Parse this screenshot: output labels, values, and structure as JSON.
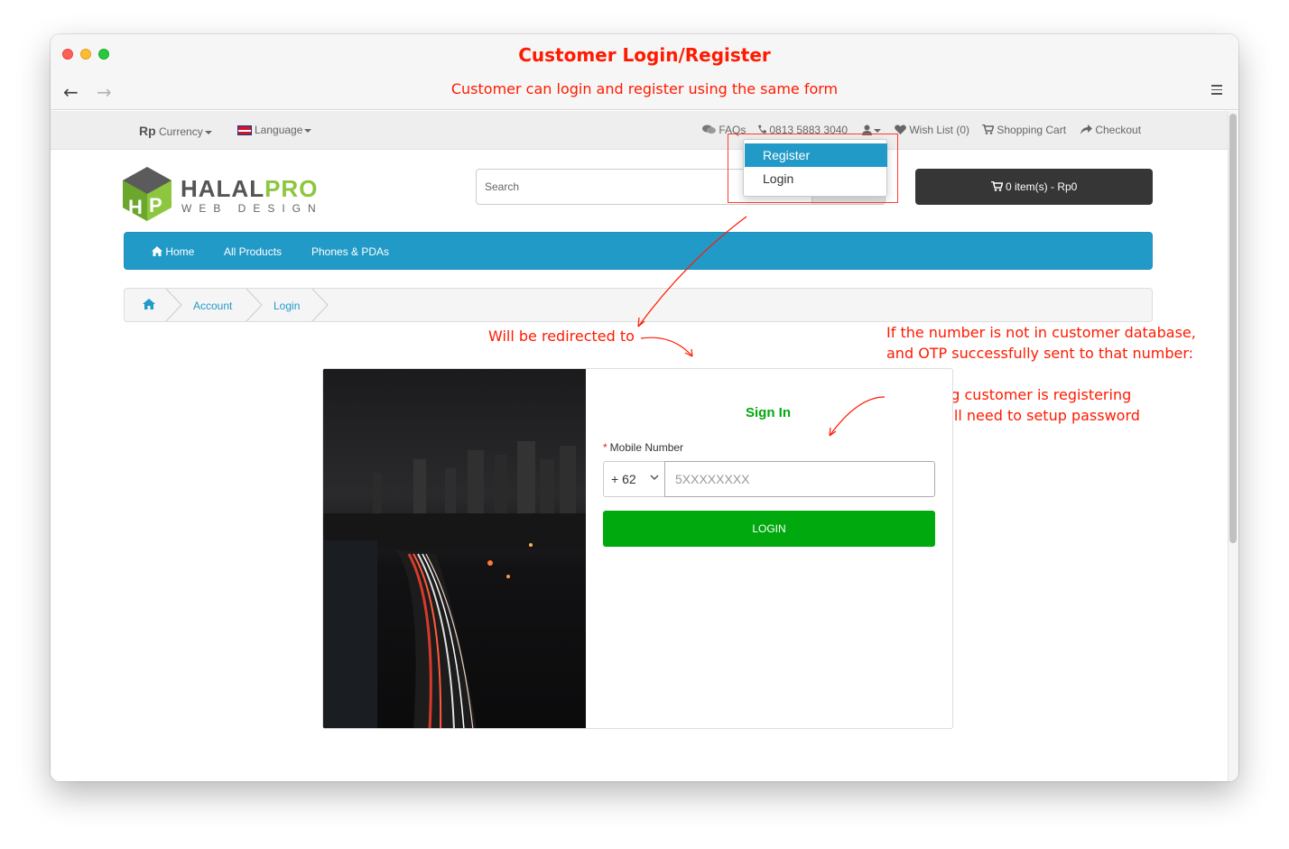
{
  "window": {
    "title": "Customer Login/Register",
    "subtitle": "Customer can login and register using the same form"
  },
  "topbar": {
    "currency_symbol": "Rp",
    "currency_label": "Currency",
    "language_label": "Language",
    "faqs": "FAQs",
    "phone": "0813 5883 3040",
    "wishlist": "Wish List (0)",
    "cart": "Shopping Cart",
    "checkout": "Checkout"
  },
  "account_dropdown": {
    "items": [
      "Register",
      "Login"
    ],
    "active": "Register"
  },
  "header": {
    "logo_main": "HALAL",
    "logo_accent": "PRO",
    "logo_sub": "WEB DESIGN",
    "search_placeholder": "Search",
    "cart_button": "0 item(s) - Rp0"
  },
  "menu": [
    "Home",
    "All Products",
    "Phones & PDAs"
  ],
  "breadcrumb": [
    "Account",
    "Login"
  ],
  "annotations": {
    "redirect": "Will be redirected to",
    "note_line1": "If the number is not in customer database,",
    "note_line2": "and OTP successfully sent to that number:",
    "bullet1": "– Meaning customer is registering",
    "bullet2": "– They will need to setup password"
  },
  "login_form": {
    "heading": "Sign In",
    "field_label": "Mobile Number",
    "country_code": "+ 62",
    "phone_placeholder": "5XXXXXXXX",
    "submit": "LOGIN"
  },
  "colors": {
    "annotation": "#ff1a00",
    "menu_bg": "#229ac8",
    "login_green": "#00a90d",
    "cart_dark": "#363636"
  },
  "icons": [
    "comments-icon",
    "phone-icon",
    "user-icon",
    "heart-icon",
    "shopping-cart-icon",
    "share-icon",
    "home-icon"
  ]
}
